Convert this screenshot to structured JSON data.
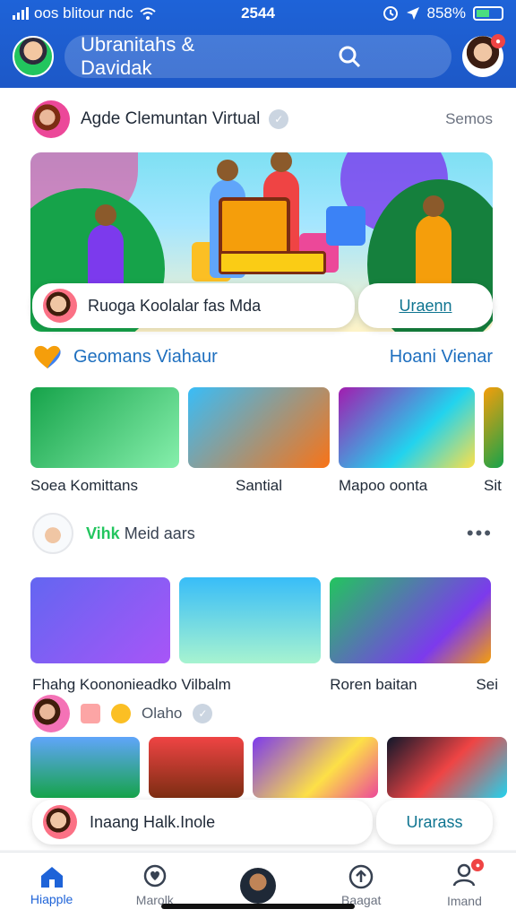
{
  "status_bar": {
    "carrier": "oos blitour ndc",
    "time": "2544",
    "battery": "858%"
  },
  "header": {
    "search_text": "Ubranitahs & Davidak"
  },
  "post1": {
    "author_title": "Agde Clemuntan Virtual",
    "right_link": "Semos"
  },
  "hero_card": {
    "pill_text": "Ruoga Koolalar fas Mda",
    "action_label": "Uraenn"
  },
  "section1": {
    "label": "Geomans Viahaur",
    "link": "Hoani Vienar",
    "items": [
      {
        "caption": "Soea Komittans"
      },
      {
        "caption": "Santial"
      },
      {
        "caption": "Mapoo oonta"
      },
      {
        "caption": "Sit"
      }
    ]
  },
  "post2": {
    "prefix": "Vihk",
    "name": "Meid aars",
    "more": "•••"
  },
  "section2": {
    "caption_left": "Fhahg Koononieadko Vilbalm",
    "caption_mid": "Roren baitan",
    "caption_right": "Sei",
    "meta_text": "Olaho"
  },
  "bottom_card": {
    "pill_text": "Inaang Halk.Inole",
    "action_label": "Urarass"
  },
  "bottom_nav": {
    "items": [
      {
        "label": "Hiapple",
        "icon": "home-icon"
      },
      {
        "label": "Marolk",
        "icon": "heart-chat-icon"
      },
      {
        "label": "",
        "icon": "profile-center-icon"
      },
      {
        "label": "Baagat",
        "icon": "upload-circle-icon"
      },
      {
        "label": "Imand",
        "icon": "user-icon"
      }
    ]
  }
}
